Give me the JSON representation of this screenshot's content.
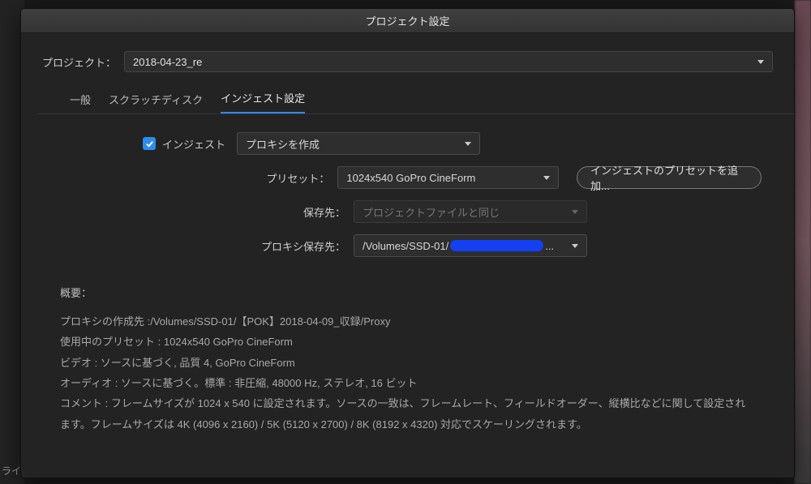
{
  "titlebar": "プロジェクト設定",
  "project": {
    "label": "プロジェクト：",
    "value": "2018-04-23_re"
  },
  "tabs": {
    "general": "一般",
    "scratch": "スクラッチディスク",
    "ingest": "インジェスト設定"
  },
  "ingest": {
    "checkbox_label": "インジェスト",
    "mode_value": "プロキシを作成",
    "preset_label": "プリセット：",
    "preset_value": "1024x540 GoPro CineForm",
    "add_preset_btn": "インジェストのプリセットを追加...",
    "primary_dest_label": "保存先：",
    "primary_dest_value": "プロジェクトファイルと同じ",
    "proxy_dest_label": "プロキシ保存先：",
    "proxy_dest_value_prefix": "/Volumes/SSD-01/",
    "proxy_dest_value_suffix": "..."
  },
  "summary": {
    "title": "概要：",
    "line1": "プロキシの作成先 :/Volumes/SSD-01/【POK】2018-04-09_収録/Proxy",
    "line2": "使用中のプリセット : 1024x540 GoPro CineForm",
    "line3": "ビデオ : ソースに基づく, 品質 4, GoPro CineForm",
    "line4": "オーディオ : ソースに基づく。標準 : 非圧縮, 48000 Hz, ステレオ, 16 ビット",
    "line5": "コメント : フレームサイズが 1024 x 540 に設定されます。ソースの一致は、フレームレート、フィールドオーダー、縦横比などに関して設定されます。フレームサイズは 4K (4096 x 2160) / 5K (5120 x 2700) / 8K (8192 x 4320) 対応でスケーリングされます。"
  },
  "side_label": "ライ"
}
